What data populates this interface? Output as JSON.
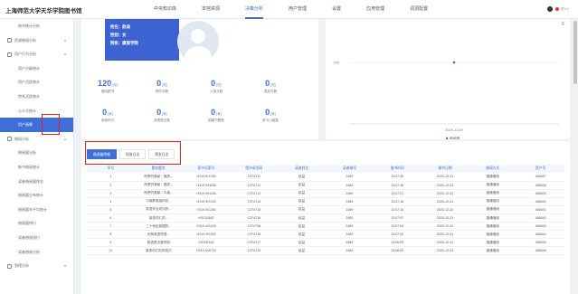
{
  "header": {
    "brand": "上海师范大学天华学院图书馆",
    "nav": [
      "中央知识库",
      "本馆资源",
      "决策分析",
      "用户管理",
      "设置",
      "应用管理",
      "词洞配置"
    ],
    "active_nav": 2,
    "user": "李XX"
  },
  "sidebar": {
    "rows": [
      {
        "label": "借书统计分析",
        "kind": "sub"
      },
      {
        "label": "资源借阅分析",
        "kind": "group",
        "caret": "▾"
      },
      {
        "label": "用户行为分析",
        "kind": "group",
        "caret": "▴"
      },
      {
        "label": "用户分级统计",
        "kind": "sub"
      },
      {
        "label": "用户活跃统计",
        "kind": "sub"
      },
      {
        "label": "院系活跃统计",
        "kind": "sub"
      },
      {
        "label": "公众号统计",
        "kind": "sub"
      },
      {
        "label": "用户画像",
        "kind": "sub",
        "active": true
      },
      {
        "label": "借阅分析",
        "kind": "group",
        "caret": "▴"
      },
      {
        "label": "借阅量分析",
        "kind": "sub"
      },
      {
        "label": "新书借阅统计",
        "kind": "sub"
      },
      {
        "label": "读者借阅量排名",
        "kind": "sub"
      },
      {
        "label": "借阅量分布统计",
        "kind": "sub"
      },
      {
        "label": "借阅量年平均统计",
        "kind": "sub"
      },
      {
        "label": "借阅量排行",
        "kind": "sub"
      },
      {
        "label": "读者借阅排行",
        "kind": "sub"
      },
      {
        "label": "读者借阅分析",
        "kind": "sub"
      },
      {
        "label": "到馆分析",
        "kind": "group",
        "caret": "▾"
      }
    ]
  },
  "profile": {
    "name_line": "姓名：赵益",
    "gender_line": "性别：女",
    "dept_line": "院系：康旅学院",
    "stats": [
      {
        "num": "120",
        "unit": "(次)",
        "label": "借阅图书"
      },
      {
        "num": "0",
        "unit": "(次)",
        "label": "预约次数"
      },
      {
        "num": "0",
        "unit": "(次)",
        "label": "入馆次数"
      },
      {
        "num": "0",
        "unit": "(次)",
        "label": "发起次数"
      },
      {
        "num": "0",
        "unit": "(本)",
        "label": "阅读时长"
      },
      {
        "num": "0",
        "unit": "(本)",
        "label": "查看笔记数"
      },
      {
        "num": "0",
        "unit": "(本)",
        "label": "团建书籍数"
      },
      {
        "num": "0",
        "unit": "(本)",
        "label": "参与小组数"
      }
    ]
  },
  "chart_data": {
    "type": "line",
    "x": [
      "2020-11-09"
    ],
    "series": [
      {
        "name": "借阅量",
        "values": [
          728
        ]
      }
    ],
    "ytick": "728",
    "xtick": "2020-11-09",
    "color": "#3e6fd9"
  },
  "table": {
    "tabs": [
      "借阅量明细",
      "续借日志",
      "预发日志"
    ],
    "active_tab": 0,
    "columns": [
      "序号",
      "题名题名",
      "索书号索号",
      "馆书条形码",
      "读者姓名",
      "读者借号",
      "借书时间",
      "借书日期",
      "借阅方式",
      "资产号"
    ],
    "rows": [
      [
        "1",
        "阿罗的奥秘：福茨...",
        "H319.9/X765",
        "C374711",
        "赵益",
        "2489",
        "13:07:35",
        "2020-12-31",
        "普通借阅",
        "466537"
      ],
      [
        "2",
        "阿罗的奥秘：福茨...",
        "H319.9/H535",
        "C374712",
        "赵益",
        "2489",
        "13:07:26",
        "2020-12-31",
        "普通借阅",
        "466538"
      ],
      [
        "3",
        "阿罗的奥秘：中级...",
        "H319.9/H156",
        "C374713",
        "赵益",
        "2489",
        "13:07:21",
        "2020-12-31",
        "普通借阅",
        "466539"
      ],
      [
        "4",
        "巧用群英组织访...",
        "H319.9/S763",
        "C374714",
        "赵益",
        "2489",
        "13:07:18",
        "2020-12-31",
        "普通借阅",
        "466540"
      ],
      [
        "5",
        "英语学业成功的...",
        "H319.9/C284",
        "C374715",
        "赵益",
        "2489",
        "13:07:10",
        "2020-12-31",
        "普通借阅",
        "466541"
      ],
      [
        "6",
        "英语词汇的...",
        "H313/J652",
        "C374716",
        "赵益",
        "2489",
        "13:07:07",
        "2020-12-31",
        "普通借阅",
        "466542"
      ],
      [
        "7",
        "二十世纪英国的...",
        "H319.4/G425",
        "C374708",
        "赵益",
        "2489",
        "13:07:04",
        "2020-12-31",
        "普通借阅",
        "466543"
      ],
      [
        "8",
        "剑桥英语短语...",
        "H319.4/S769",
        "C374718",
        "赵益",
        "2489",
        "13:07:00",
        "2020-12-31",
        "普通借阅",
        "466544"
      ],
      [
        "9",
        "英语语法速学指",
        "H31/W164",
        "C374717",
        "赵益",
        "2489",
        "13:06:59",
        "2020-12-31",
        "普通借阅",
        "466545"
      ],
      [
        "10",
        "英语词汇构词技巧",
        "H319.4/W753",
        "C374710",
        "赵益",
        "2489",
        "13:06:52",
        "2020-12-31",
        "普通借阅",
        "466546"
      ]
    ]
  }
}
